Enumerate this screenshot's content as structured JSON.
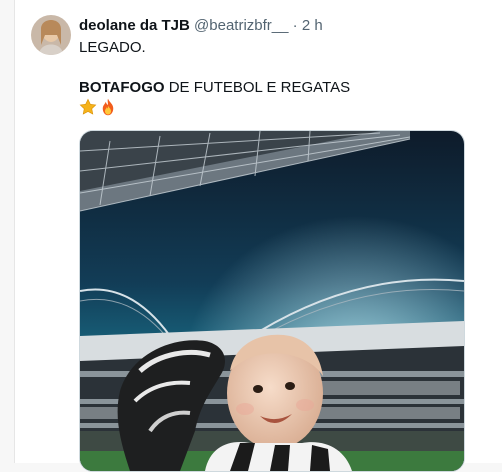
{
  "tweet": {
    "display_name": "deolane da TJB",
    "handle": "@beatrizbfr__",
    "separator": "·",
    "time": "2 h",
    "line1": "LEGADO.",
    "line2_bold": "BOTAFOGO",
    "line2_rest": " DE FUTEBOL E REGATAS",
    "emojis": [
      "star",
      "fire"
    ]
  },
  "colors": {
    "text": "#0f1419",
    "muted": "#536471",
    "border": "#cfd9de"
  }
}
